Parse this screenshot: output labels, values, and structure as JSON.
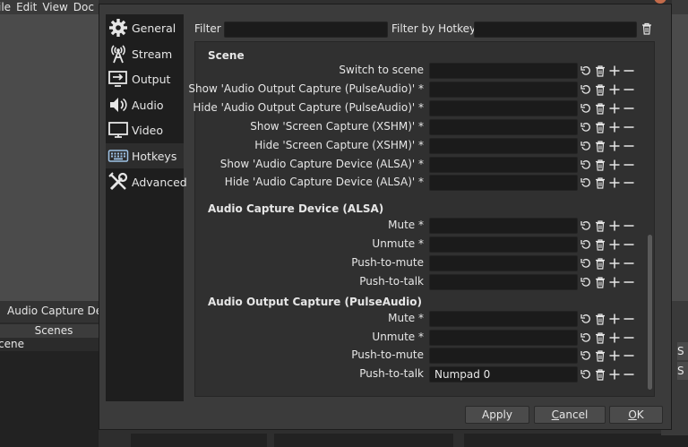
{
  "background": {
    "menu": [
      "ile",
      "Edit",
      "View",
      "Doc"
    ],
    "source_label": "Audio Capture Dev",
    "scenes_header": "Scenes",
    "scene_item": "cene",
    "right_cells": [
      "S",
      "S"
    ]
  },
  "sidebar": {
    "items": [
      {
        "label": "General",
        "icon": "gear-icon"
      },
      {
        "label": "Stream",
        "icon": "antenna-icon"
      },
      {
        "label": "Output",
        "icon": "output-icon"
      },
      {
        "label": "Audio",
        "icon": "speaker-icon"
      },
      {
        "label": "Video",
        "icon": "monitor-icon"
      },
      {
        "label": "Hotkeys",
        "icon": "keyboard-icon"
      },
      {
        "label": "Advanced",
        "icon": "tools-icon"
      }
    ],
    "active": "Hotkeys"
  },
  "filter": {
    "label": "Filter",
    "hotkey_label": "Filter by Hotkey",
    "value": "",
    "hotkey_value": ""
  },
  "sections": [
    {
      "title": "Scene",
      "rows": [
        {
          "label": "Switch to scene",
          "value": ""
        },
        {
          "label": "Show 'Audio Output Capture (PulseAudio)' *",
          "value": ""
        },
        {
          "label": "Hide 'Audio Output Capture (PulseAudio)' *",
          "value": ""
        },
        {
          "label": "Show 'Screen Capture (XSHM)' *",
          "value": ""
        },
        {
          "label": "Hide 'Screen Capture (XSHM)' *",
          "value": ""
        },
        {
          "label": "Show 'Audio Capture Device (ALSA)' *",
          "value": ""
        },
        {
          "label": "Hide 'Audio Capture Device (ALSA)' *",
          "value": ""
        }
      ]
    },
    {
      "title": "Audio Capture Device (ALSA)",
      "rows": [
        {
          "label": "Mute *",
          "value": ""
        },
        {
          "label": "Unmute *",
          "value": ""
        },
        {
          "label": "Push-to-mute",
          "value": ""
        },
        {
          "label": "Push-to-talk",
          "value": ""
        }
      ]
    },
    {
      "title": "Audio Output Capture (PulseAudio)",
      "rows": [
        {
          "label": "Mute *",
          "value": ""
        },
        {
          "label": "Unmute *",
          "value": ""
        },
        {
          "label": "Push-to-mute",
          "value": ""
        },
        {
          "label": "Push-to-talk",
          "value": "Numpad 0"
        }
      ]
    }
  ],
  "row_buttons": [
    "revert-icon",
    "trash-icon",
    "plus-icon",
    "minus-icon"
  ],
  "buttons": {
    "apply": "Apply",
    "cancel_first": "C",
    "cancel_rest": "ancel",
    "ok_first": "O",
    "ok_rest": "K"
  },
  "colors": {
    "dialog_bg": "#3b3b3b",
    "panel_bg": "#303030",
    "input_bg": "#1b1b1b",
    "sidebar_bg": "#1e1e1e",
    "text": "#e6e6e6"
  }
}
